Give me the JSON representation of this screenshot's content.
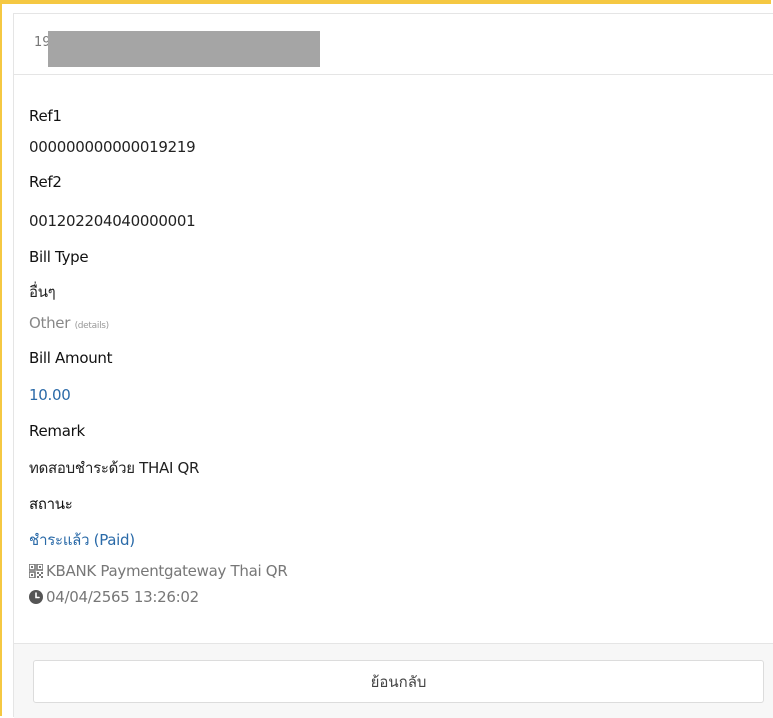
{
  "header": {
    "id_prefix": "19"
  },
  "fields": {
    "ref1_label": "Ref1",
    "ref1_value": "000000000000019219",
    "ref2_label": "Ref2",
    "ref2_value": "001202204040000001",
    "bill_type_label": "Bill Type",
    "bill_type_value_th": "อื่นๆ",
    "bill_type_value_en": "Other",
    "bill_type_details": "(details)",
    "bill_amount_label": "Bill Amount",
    "bill_amount_value": "10.00",
    "remark_label": "Remark",
    "remark_value": "ทดสอบชำระด้วย THAI QR",
    "status_label": "สถานะ",
    "status_value": "ชำระแล้ว (Paid)"
  },
  "meta": {
    "gateway": "KBANK Paymentgateway Thai QR",
    "gateway_icon": "qr-code-icon",
    "timestamp": "04/04/2565 13:26:02",
    "timestamp_icon": "clock-icon"
  },
  "footer": {
    "back_label": "ย้อนกลับ"
  },
  "colors": {
    "accent_border": "#f5c842",
    "link_blue": "#2a6aa8",
    "redaction": "#a5a5a5"
  }
}
